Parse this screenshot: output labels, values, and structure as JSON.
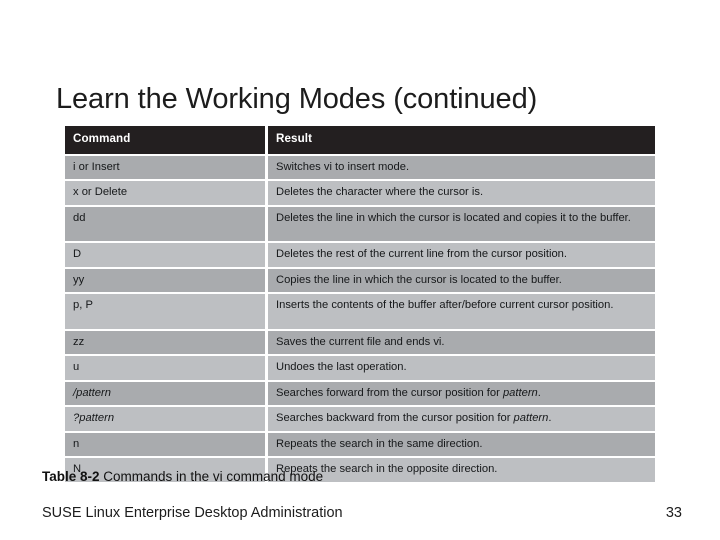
{
  "slide": {
    "title": "Learn the Working Modes (continued)",
    "background_color": "#ffffff"
  },
  "table": {
    "header_bg": "#231f20",
    "header_text_color": "#ffffff",
    "row_dark_bg": "#a9abae",
    "row_light_bg": "#bdbfc2",
    "columns": [
      "Command",
      "Result"
    ],
    "rows": [
      {
        "command": "i or Insert",
        "command_italic": false,
        "result_pre": "Switches vi to insert mode.",
        "result_italic": "",
        "result_post": "",
        "shade": "dark"
      },
      {
        "command": "x or Delete",
        "command_italic": false,
        "result_pre": "Deletes the character where the cursor is.",
        "result_italic": "",
        "result_post": "",
        "shade": "light"
      },
      {
        "command": "dd",
        "command_italic": false,
        "result_pre": "Deletes the line in which the cursor is located and copies it to the buffer.",
        "result_italic": "",
        "result_post": "",
        "shade": "dark"
      },
      {
        "command": "D",
        "command_italic": false,
        "result_pre": "Deletes the rest of the current line from the cursor position.",
        "result_italic": "",
        "result_post": "",
        "shade": "light"
      },
      {
        "command": "yy",
        "command_italic": false,
        "result_pre": "Copies the line in which the cursor is located to the buffer.",
        "result_italic": "",
        "result_post": "",
        "shade": "dark"
      },
      {
        "command": "p, P",
        "command_italic": false,
        "result_pre": "Inserts the contents of the buffer after/before current cursor position.",
        "result_italic": "",
        "result_post": "",
        "shade": "light"
      },
      {
        "command": "zz",
        "command_italic": false,
        "result_pre": "Saves the current file and ends vi.",
        "result_italic": "",
        "result_post": "",
        "shade": "dark"
      },
      {
        "command": "u",
        "command_italic": false,
        "result_pre": "Undoes the last operation.",
        "result_italic": "",
        "result_post": "",
        "shade": "light"
      },
      {
        "command": "/pattern",
        "command_italic": true,
        "result_pre": "Searches forward from the cursor position for ",
        "result_italic": "pattern",
        "result_post": ".",
        "shade": "dark"
      },
      {
        "command": "?pattern",
        "command_italic": true,
        "result_pre": "Searches backward from the cursor position for ",
        "result_italic": "pattern",
        "result_post": ".",
        "shade": "light"
      },
      {
        "command": "n",
        "command_italic": false,
        "result_pre": "Repeats the search in the same direction.",
        "result_italic": "",
        "result_post": "",
        "shade": "dark"
      },
      {
        "command": "N",
        "command_italic": false,
        "result_pre": "Repeats the search in the opposite direction.",
        "result_italic": "",
        "result_post": "",
        "shade": "light"
      }
    ]
  },
  "caption": {
    "label": "Table 8-2",
    "text": " Commands in the vi command mode"
  },
  "footer": {
    "title": "SUSE Linux Enterprise Desktop Administration",
    "page": "33"
  }
}
